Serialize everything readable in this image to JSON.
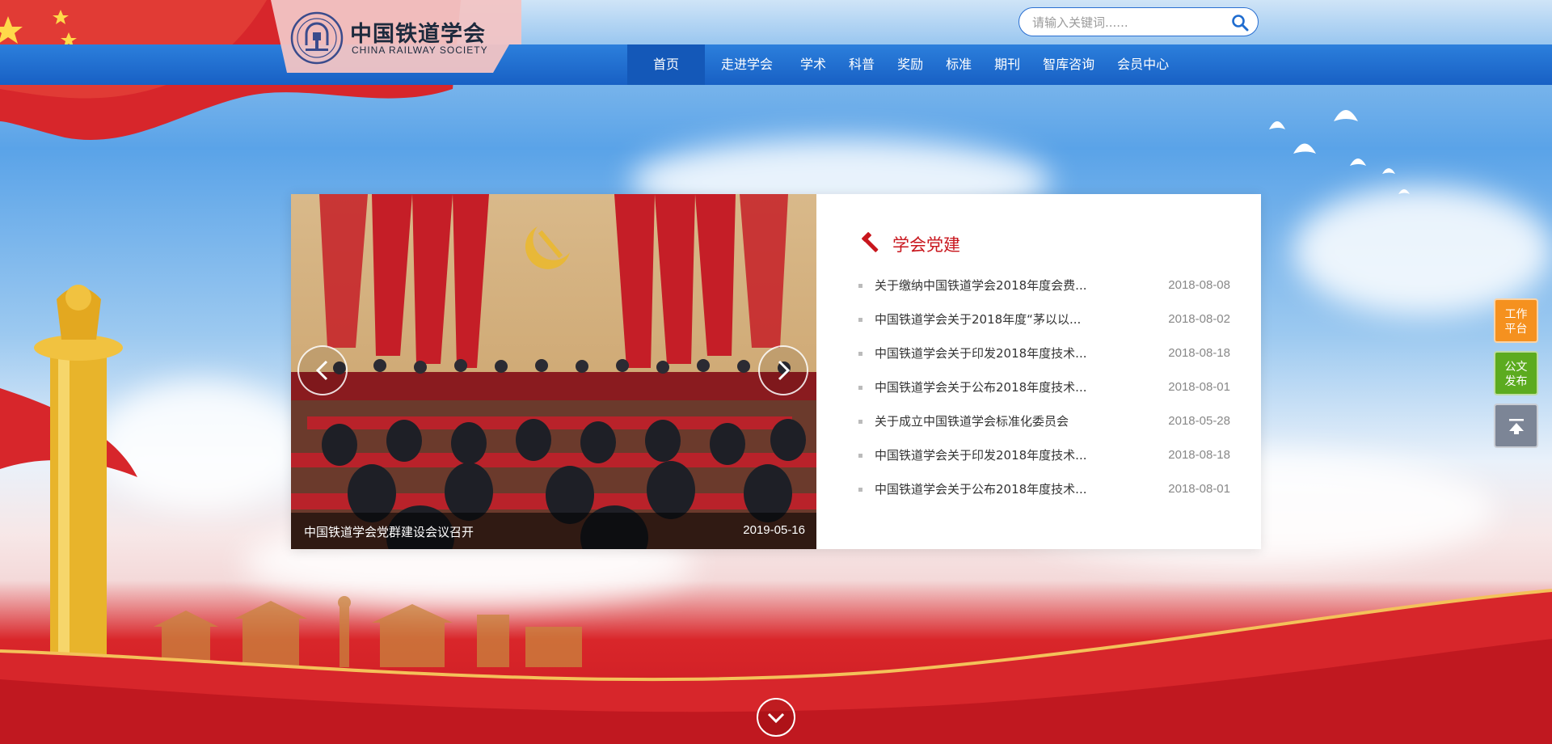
{
  "site": {
    "name_cn": "中国铁道学会",
    "name_en": "CHINA RAILWAY SOCIETY"
  },
  "search": {
    "placeholder": "请输入关键词......",
    "icon": "search-icon"
  },
  "nav": {
    "items": [
      {
        "label": "首页",
        "active": true
      },
      {
        "label": "走进学会"
      },
      {
        "label": "学术"
      },
      {
        "label": "科普"
      },
      {
        "label": "奖励"
      },
      {
        "label": "标准"
      },
      {
        "label": "期刊"
      },
      {
        "label": "智库咨询"
      },
      {
        "label": "会员中心"
      }
    ]
  },
  "slider": {
    "caption_title": "中国铁道学会党群建设会议召开",
    "caption_date": "2019-05-16"
  },
  "party_news": {
    "title": "学会党建",
    "icon": "hammer-sickle-icon",
    "items": [
      {
        "title": "关于缴纳中国铁道学会2018年度会费...",
        "date": "2018-08-08"
      },
      {
        "title": "中国铁道学会关于2018年度“茅以以...",
        "date": "2018-08-02"
      },
      {
        "title": "中国铁道学会关于印发2018年度技术...",
        "date": "2018-08-18"
      },
      {
        "title": "中国铁道学会关于公布2018年度技术...",
        "date": "2018-08-01"
      },
      {
        "title": "关于成立中国铁道学会标准化委员会",
        "date": "2018-05-28"
      },
      {
        "title": "中国铁道学会关于印发2018年度技术...",
        "date": "2018-08-18"
      },
      {
        "title": "中国铁道学会关于公布2018年度技术...",
        "date": "2018-08-01"
      }
    ]
  },
  "side": {
    "work_platform": "工作\n平台",
    "doc_publish": "公文\n发布"
  },
  "colors": {
    "nav_blue": "#1860c4",
    "party_red": "#c8161d",
    "work_orange": "#f5911f",
    "doc_green": "#5cab1f"
  }
}
